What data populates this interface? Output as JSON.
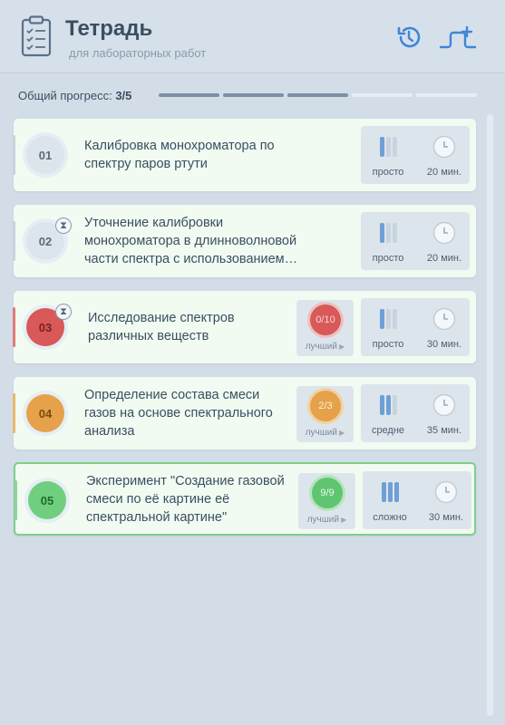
{
  "header": {
    "title": "Тетрадь",
    "subtitle": "для лабораторных работ",
    "icons": {
      "logo": "clipboard-checklist-icon",
      "history": "history-icon",
      "add": "add-experiment-icon"
    }
  },
  "progress": {
    "label": "Общий прогресс:",
    "value_text": "3/5",
    "completed": 3,
    "total": 5
  },
  "experiments": [
    {
      "number": "01",
      "title": "Калибровка монохроматора по спектру паров ртути",
      "status": "default",
      "has_timer": false,
      "score": null,
      "difficulty": "просто",
      "difficulty_level": 1,
      "time": "20 мин."
    },
    {
      "number": "02",
      "title": "Уточнение калибровки монохроматора в длинноволновой части спектра с использованием…",
      "status": "default",
      "has_timer": true,
      "score": null,
      "difficulty": "просто",
      "difficulty_level": 1,
      "time": "20 мин."
    },
    {
      "number": "03",
      "title": "Исследование спектров различных веществ",
      "status": "red",
      "has_timer": true,
      "score": {
        "text": "0/10",
        "label": "лучший"
      },
      "difficulty": "просто",
      "difficulty_level": 1,
      "time": "30 мин."
    },
    {
      "number": "04",
      "title": "Определение состава смеси газов на основе спектрального анализа",
      "status": "orange",
      "has_timer": false,
      "score": {
        "text": "2/3",
        "label": "лучший"
      },
      "difficulty": "средне",
      "difficulty_level": 2,
      "time": "35 мин."
    },
    {
      "number": "05",
      "title": "Эксперимент \"Создание газовой смеси по её картине её спектральной картине\"",
      "status": "green",
      "has_timer": false,
      "score": {
        "text": "9/9",
        "label": "лучший"
      },
      "difficulty": "сложно",
      "difficulty_level": 3,
      "time": "30 мин.",
      "active": true
    }
  ],
  "colors": {
    "red": "#d95858",
    "orange": "#e5a24a",
    "green": "#5fc570",
    "difficulty_bar": "#6f9fd6"
  }
}
